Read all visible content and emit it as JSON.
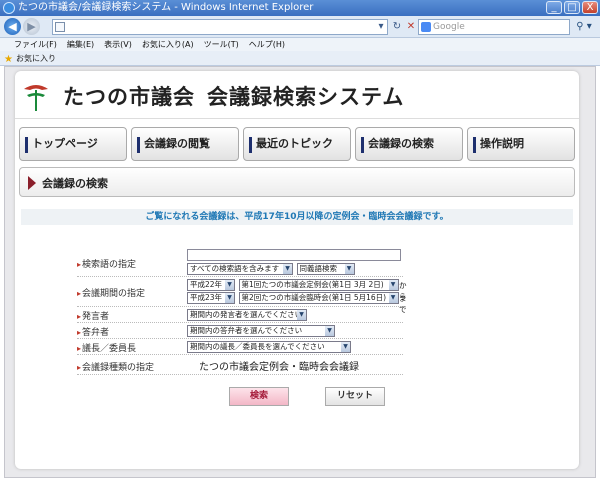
{
  "window": {
    "title": "たつの市議会/会議録検索システム - Windows Internet Explorer",
    "min_label": "_",
    "max_label": "□",
    "close_label": "X"
  },
  "browser": {
    "back_label": "◀",
    "forward_label": "▶",
    "address_value": "",
    "search_placeholder": "Google",
    "menu": [
      "ファイル(F)",
      "編集(E)",
      "表示(V)",
      "お気に入り(A)",
      "ツール(T)",
      "ヘルプ(H)"
    ],
    "favorites_label": "お気に入り"
  },
  "site": {
    "name": "たつの市議会",
    "subtitle": "会議録検索システム"
  },
  "nav": {
    "tabs": [
      "トップページ",
      "会議録の閲覧",
      "最近のトピック",
      "会議録の検索",
      "操作説明"
    ]
  },
  "section": {
    "title": "会議録の検索"
  },
  "notice": "ご覧になれる会議録は、平成17年10月以降の定例会・臨時会会議録です。",
  "form": {
    "keyword": {
      "label": "検索語の指定",
      "value": "",
      "mode": "すべての検索語を含みます",
      "type": "同義語検索"
    },
    "period": {
      "label": "会議期間の指定",
      "from_year": "平成22年",
      "from_session": "第1回たつの市議会定例会(第1日 3月 2日)",
      "from_suffix": "から",
      "to_year": "平成23年",
      "to_session": "第2回たつの市議会臨時会(第1日 5月16日)",
      "to_suffix": "まで"
    },
    "speaker": {
      "label": "発言者",
      "value": "期間内の発言者を選んでください"
    },
    "answerer": {
      "label": "答弁者",
      "value": "期間内の答弁者を選んでください"
    },
    "chair": {
      "label": "議長／委員長",
      "value": "期間内の議長／委員長を選んでください"
    },
    "meeting_type": {
      "label": "会議録種類の指定",
      "value": "たつの市議会定例会・臨時会会議録"
    }
  },
  "buttons": {
    "search": "検索",
    "reset": "リセット"
  }
}
